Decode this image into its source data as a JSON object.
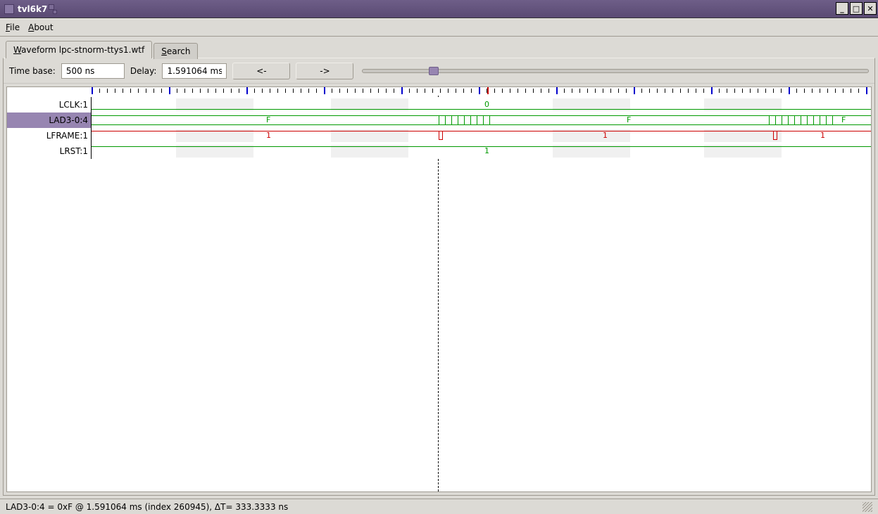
{
  "window": {
    "title": "tvl6k7"
  },
  "menubar": {
    "file": "File",
    "about": "About"
  },
  "tabs": {
    "waveform": "Waveform lpc-stnorm-ttys1.wtf",
    "search": "Search"
  },
  "controls": {
    "timebase_label": "Time base:",
    "timebase_value": "500 ns",
    "delay_label": "Delay:",
    "delay_value": "1.591064 ms",
    "prev": "<-",
    "next": "->"
  },
  "signals": [
    {
      "name": "LCLK:1",
      "value": "0",
      "selected": false
    },
    {
      "name": "LAD3-0:4",
      "value": "F",
      "selected": true
    },
    {
      "name": "LFRAME:1",
      "value": "1",
      "selected": false
    },
    {
      "name": "LRST:1",
      "value": "1",
      "selected": false
    }
  ],
  "wave_values": {
    "lad_f_left": "F",
    "lad_f_mid": "F",
    "lad_f_right": "F",
    "lframe_1_a": "1",
    "lframe_1_b": "1",
    "lframe_1_c": "1"
  },
  "status": "LAD3-0:4 = 0xF @ 1.591064 ms  (index 260945), ΔT= 333.3333 ns"
}
